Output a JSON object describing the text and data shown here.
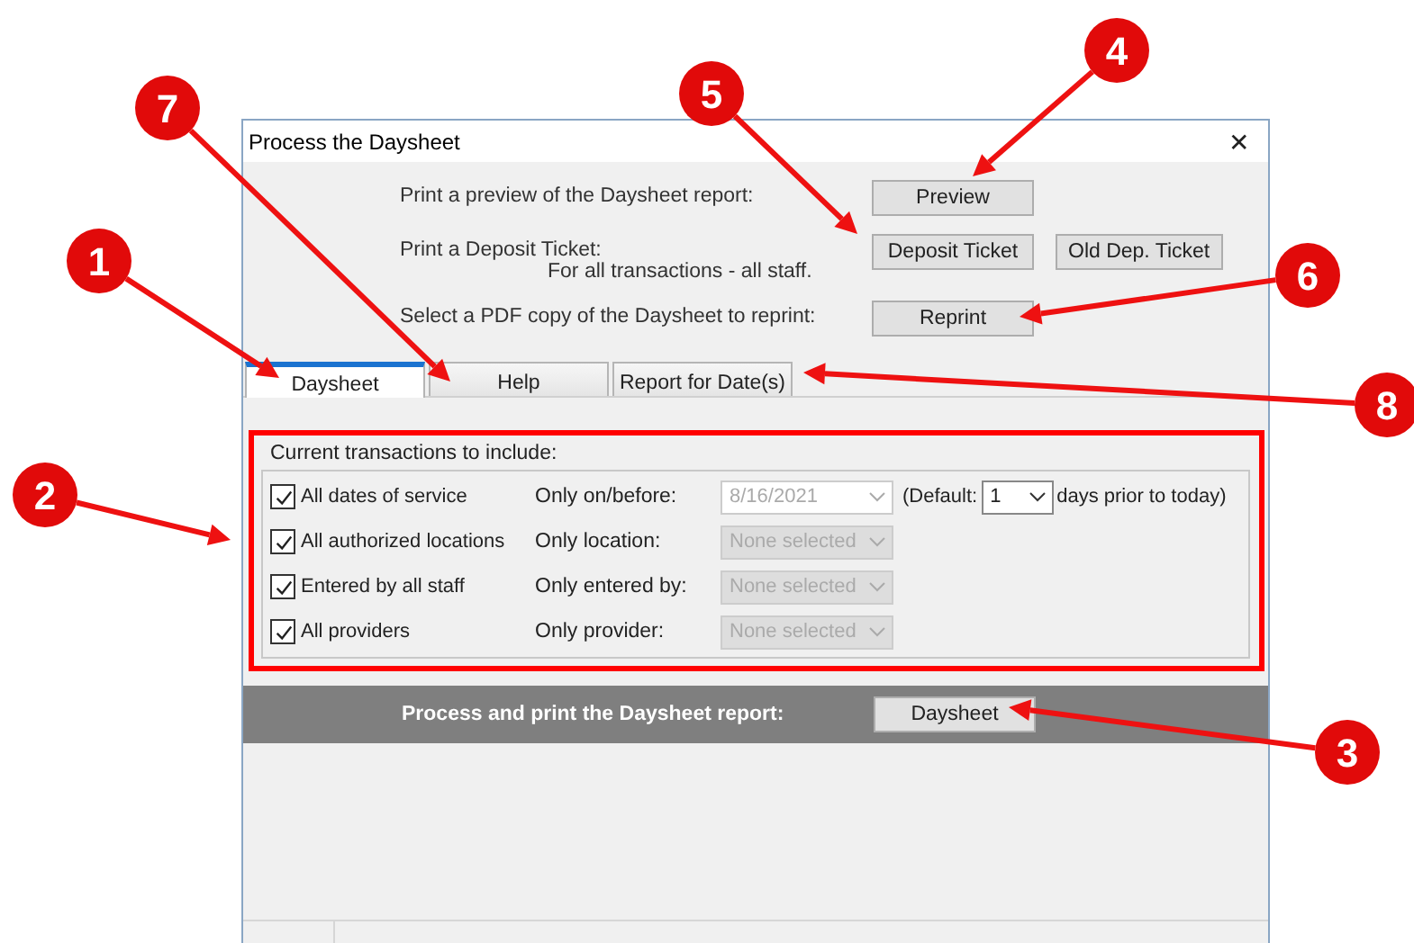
{
  "window": {
    "title": "Process the Daysheet",
    "close": "✕"
  },
  "actions": [
    {
      "label": "Print a preview of the Daysheet report:",
      "buttons": [
        "Preview"
      ]
    },
    {
      "label": "Print a Deposit Ticket:",
      "sublabel": "For all transactions - all staff.",
      "buttons": [
        "Deposit Ticket",
        "Old Dep. Ticket"
      ]
    },
    {
      "label": "Select a PDF copy of the Daysheet to reprint:",
      "buttons": [
        "Reprint"
      ]
    }
  ],
  "tabs": [
    {
      "label": "Daysheet",
      "selected": true
    },
    {
      "label": "Help",
      "selected": false
    },
    {
      "label": "Report for Date(s)",
      "selected": false
    }
  ],
  "group": {
    "title": "Current transactions to include:",
    "rows": [
      {
        "label": "All dates of service",
        "checked": true,
        "filter_label": "Only on/before:",
        "filter": {
          "kind": "date",
          "value": "8/16/2021",
          "disabled": true
        },
        "default_label": "(Default:",
        "default_value": "1",
        "default_suffix": "days prior to today)"
      },
      {
        "label": "All authorized locations",
        "checked": true,
        "filter_label": "Only location:",
        "filter": {
          "kind": "list",
          "value": "None selected",
          "disabled": true
        }
      },
      {
        "label": "Entered by all staff",
        "checked": true,
        "filter_label": "Only entered by:",
        "filter": {
          "kind": "list",
          "value": "None selected",
          "disabled": true
        }
      },
      {
        "label": "All providers",
        "checked": true,
        "filter_label": "Only provider:",
        "filter": {
          "kind": "list",
          "value": "None selected",
          "disabled": true
        }
      }
    ]
  },
  "process": {
    "label": "Process and print the Daysheet report:",
    "button": "Daysheet"
  },
  "callouts": [
    {
      "number": "1"
    },
    {
      "number": "2"
    },
    {
      "number": "3"
    },
    {
      "number": "4"
    },
    {
      "number": "5"
    },
    {
      "number": "6"
    },
    {
      "number": "7"
    },
    {
      "number": "8"
    }
  ]
}
